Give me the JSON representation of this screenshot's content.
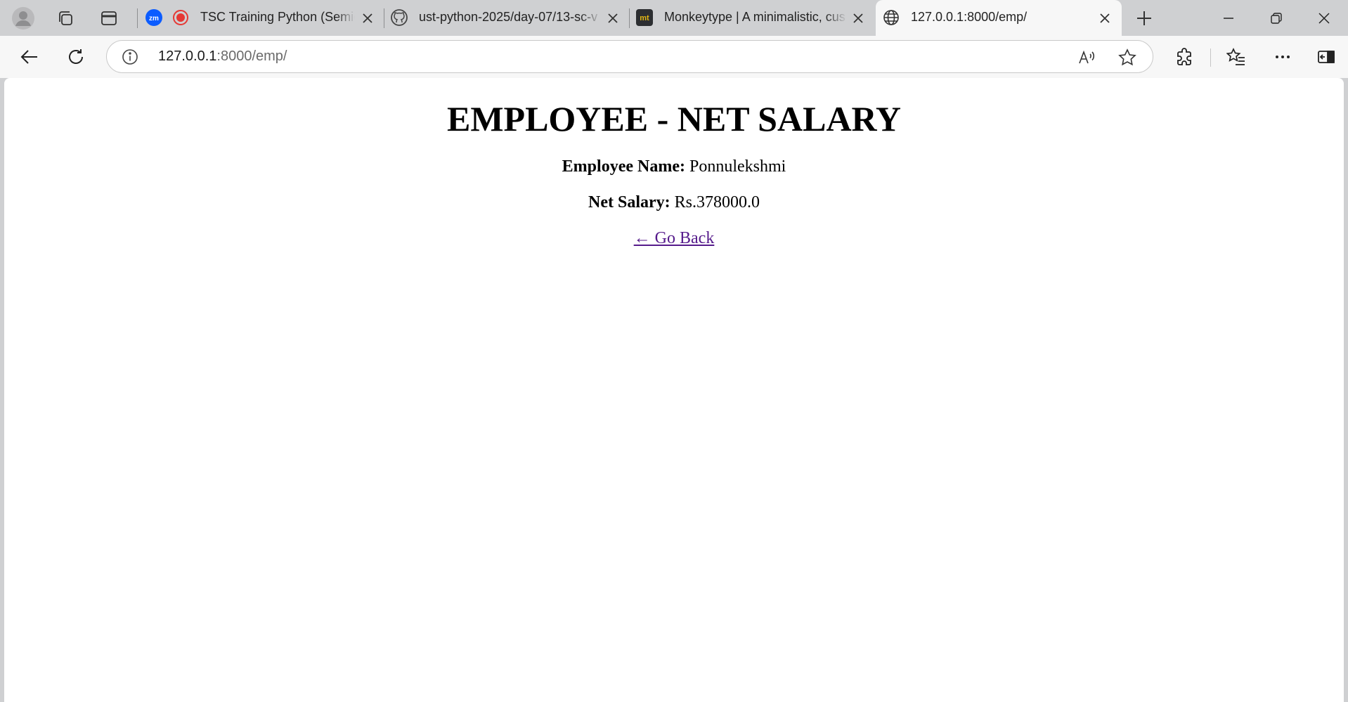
{
  "browser": {
    "tabs": [
      {
        "title": "TSC Training Python (Semic",
        "icon": "zoom-recording-icon",
        "active": false
      },
      {
        "title": "ust-python-2025/day-07/13-sc-v",
        "icon": "github-icon",
        "active": false
      },
      {
        "title": "Monkeytype | A minimalistic, cus",
        "icon": "monkeytype-icon",
        "active": false
      },
      {
        "title": "127.0.0.1:8000/emp/",
        "icon": "globe-icon",
        "active": true
      }
    ],
    "address": {
      "host": "127.0.0.1",
      "rest": ":8000/emp/"
    },
    "accent": "#0078d4"
  },
  "page": {
    "heading": "EMPLOYEE - NET SALARY",
    "name_label": "Employee Name:",
    "name_value": " Ponnulekshmi",
    "salary_label": "Net Salary:",
    "salary_value": " Rs.378000.0",
    "back_link": "← Go Back",
    "link_color": "#551a8b"
  }
}
